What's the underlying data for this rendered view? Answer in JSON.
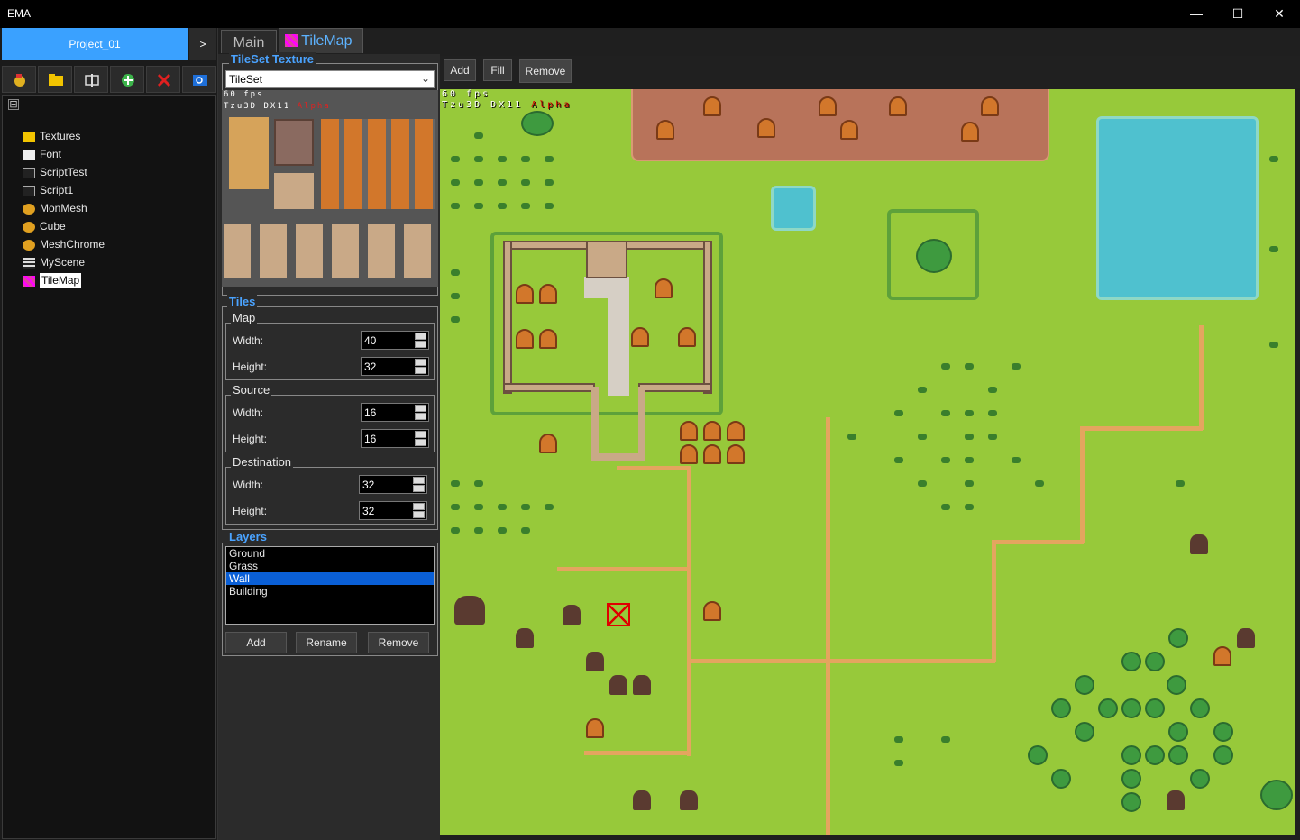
{
  "window": {
    "title": "EMA",
    "minimize": "—",
    "maximize": "☐",
    "close": "✕"
  },
  "project": {
    "name": "Project_01",
    "expand": ">"
  },
  "toolbar_icons": [
    "import-icon",
    "folder-icon",
    "text-icon",
    "add-icon",
    "delete-icon",
    "view-icon"
  ],
  "tree": {
    "expander": "⊟",
    "items": [
      {
        "label": "Textures",
        "icon": "folder-icon",
        "indent": 0
      },
      {
        "label": "Font",
        "icon": "font-icon",
        "indent": 1
      },
      {
        "label": "ScriptTest",
        "icon": "script-icon",
        "indent": 1
      },
      {
        "label": "Script1",
        "icon": "script-icon",
        "indent": 1
      },
      {
        "label": "MonMesh",
        "icon": "mesh-icon",
        "indent": 1
      },
      {
        "label": "Cube",
        "icon": "mesh-icon",
        "indent": 1
      },
      {
        "label": "MeshChrome",
        "icon": "mesh-icon",
        "indent": 1
      },
      {
        "label": "MyScene",
        "icon": "scene-icon",
        "indent": 1
      },
      {
        "label": "TileMap",
        "icon": "tilemap-icon",
        "indent": 1,
        "selected": true
      }
    ]
  },
  "tabs": {
    "main": "Main",
    "tilemap": "TileMap"
  },
  "tileset": {
    "group": "TileSet Texture",
    "selected": "TileSet",
    "fps": "60 fps",
    "engine": "Tzu3D DX11",
    "alpha": "Alpha"
  },
  "tiles": {
    "group": "Tiles",
    "map": {
      "label": "Map",
      "width_label": "Width:",
      "width": "40",
      "height_label": "Height:",
      "height": "32"
    },
    "source": {
      "label": "Source",
      "width_label": "Width:",
      "width": "16",
      "height_label": "Height:",
      "height": "16"
    },
    "destination": {
      "label": "Destination",
      "width_label": "Width:",
      "width": "32",
      "height_label": "Height:",
      "height": "32"
    }
  },
  "layers": {
    "group": "Layers",
    "items": [
      "Ground",
      "Grass",
      "Wall",
      "Building"
    ],
    "selected": "Wall",
    "add": "Add",
    "rename": "Rename",
    "remove": "Remove"
  },
  "map_toolbar": {
    "add": "Add",
    "fill": "Fill",
    "remove": "Remove"
  },
  "overlay": {
    "fps": "60 fps",
    "engine": "Tzu3D DX11",
    "alpha": "Alpha"
  },
  "colors": {
    "accent": "#3aa1ff",
    "grass": "#97c93a",
    "path": "#e4a55f",
    "water": "#4fc1cf"
  }
}
